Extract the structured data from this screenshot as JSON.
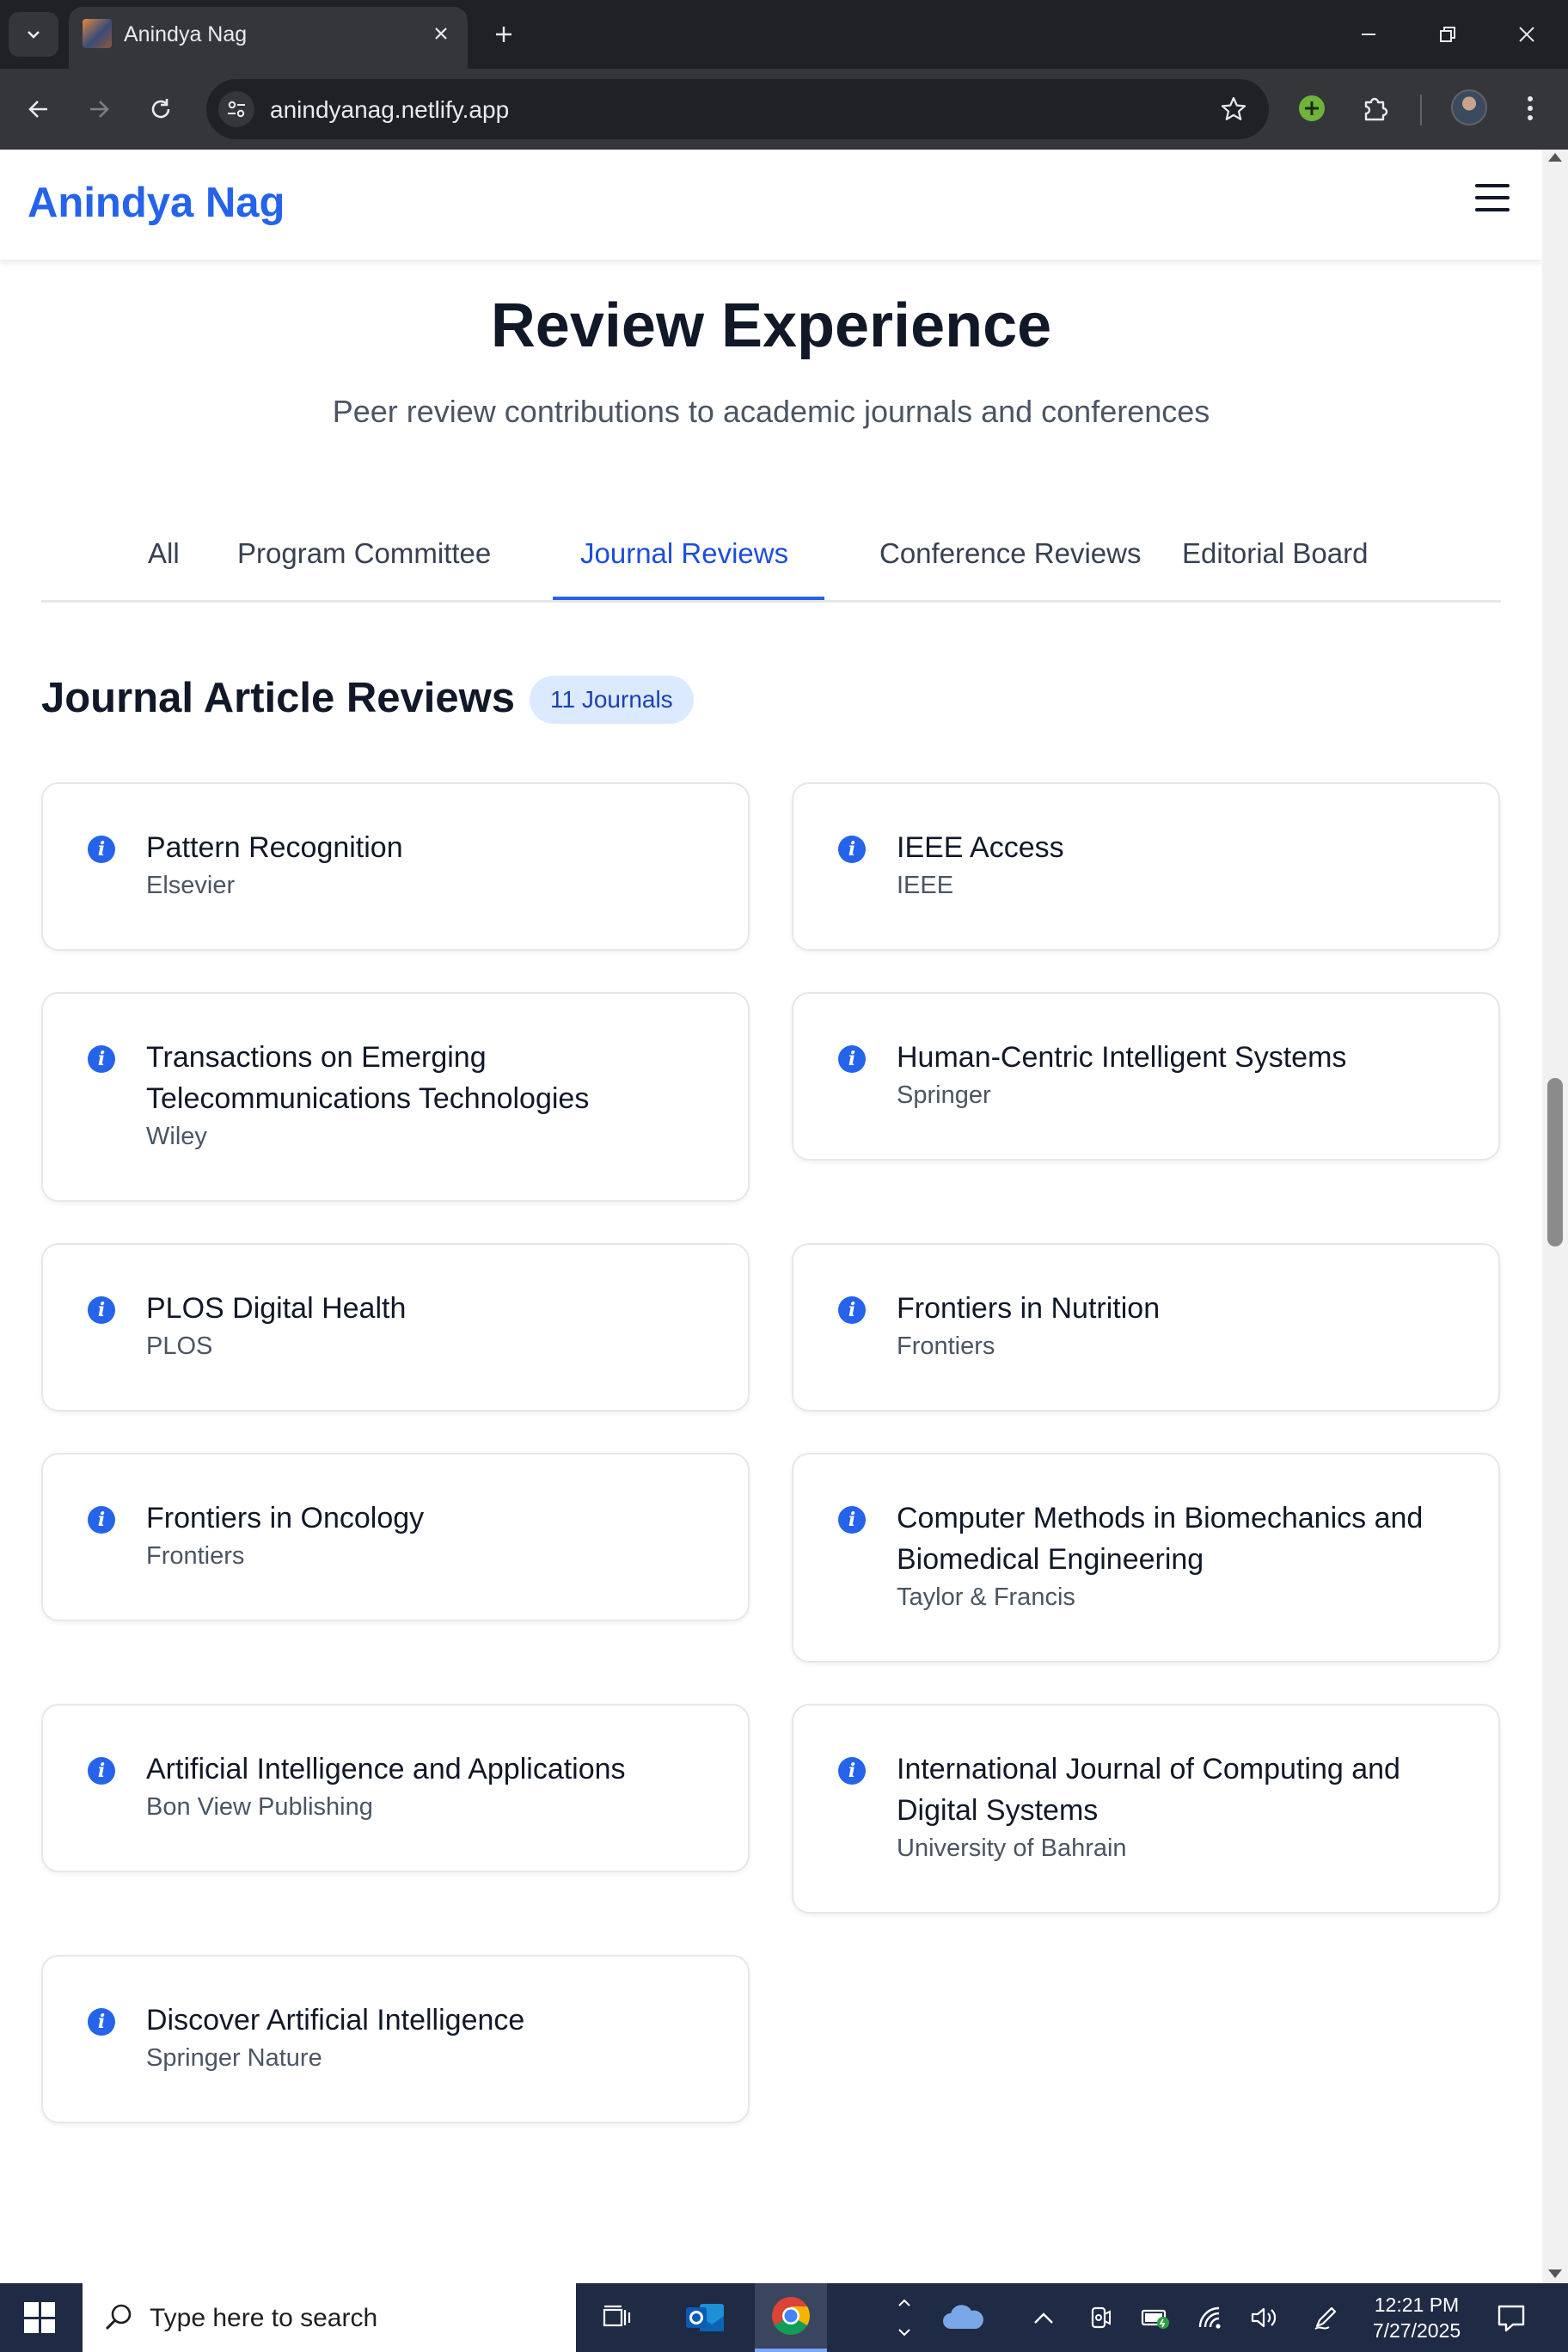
{
  "browser": {
    "tab_title": "Anindya Nag",
    "url": "anindyanag.netlify.app"
  },
  "site": {
    "brand": "Anindya Nag"
  },
  "page": {
    "title": "Review Experience",
    "subtitle": "Peer review contributions to academic journals and conferences"
  },
  "tabs": [
    {
      "label": "All"
    },
    {
      "label": "Program Committee"
    },
    {
      "label": "Journal Reviews",
      "active": true
    },
    {
      "label": "Conference Reviews"
    },
    {
      "label": "Editorial Board"
    }
  ],
  "section": {
    "title": "Journal Article Reviews",
    "badge": "11 Journals"
  },
  "journals": [
    {
      "title": "Pattern Recognition",
      "publisher": "Elsevier"
    },
    {
      "title": "IEEE Access",
      "publisher": "IEEE"
    },
    {
      "title": "Transactions on Emerging Telecommunications Technologies",
      "publisher": "Wiley"
    },
    {
      "title": "Human-Centric Intelligent Systems",
      "publisher": "Springer"
    },
    {
      "title": "PLOS Digital Health",
      "publisher": "PLOS"
    },
    {
      "title": "Frontiers in Nutrition",
      "publisher": "Frontiers"
    },
    {
      "title": "Frontiers in Oncology",
      "publisher": "Frontiers"
    },
    {
      "title": "Computer Methods in Biomechanics and Biomedical Engineering",
      "publisher": "Taylor & Francis"
    },
    {
      "title": "Artificial Intelligence and Applications",
      "publisher": "Bon View Publishing"
    },
    {
      "title": "International Journal of Computing and Digital Systems",
      "publisher": "University of Bahrain"
    },
    {
      "title": "Discover Artificial Intelligence",
      "publisher": "Springer Nature"
    }
  ],
  "taskbar": {
    "search_placeholder": "Type here to search",
    "time": "12:21 PM",
    "date": "7/27/2025"
  },
  "colors": {
    "accent": "#2563eb",
    "badge_bg": "#dbeafe",
    "chrome_dark": "#202124"
  }
}
